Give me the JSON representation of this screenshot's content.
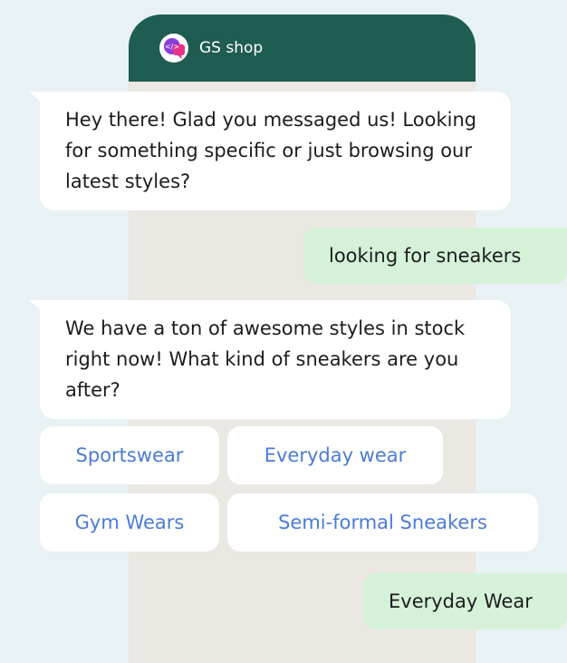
{
  "header": {
    "title": "GS shop",
    "logo_icon": "chat-code-icon",
    "color": "#1f5c51"
  },
  "messages": [
    {
      "from": "bot",
      "text": "Hey there! Glad you messaged us! Looking for something specific or just browsing our latest styles?"
    },
    {
      "from": "user",
      "text": "looking for sneakers"
    },
    {
      "from": "bot",
      "text": "We have a ton of awesome styles in stock right now! What kind of sneakers are you after?"
    },
    {
      "from": "user",
      "text": "Everyday Wear"
    }
  ],
  "quick_replies": [
    "Sportswear",
    "Everyday wear",
    "Gym Wears",
    "Semi-formal Sneakers"
  ],
  "colors": {
    "page_bg": "#e8f1f3",
    "chat_bg": "#ebe7e2",
    "user_bubble": "#d5f2d8",
    "chip_text": "#4a7bd8"
  }
}
